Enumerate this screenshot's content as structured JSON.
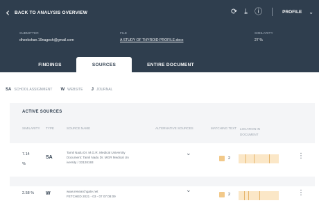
{
  "header": {
    "back_label": "BACK TO ANALYSIS OVERVIEW",
    "profile_label": "PROFILE",
    "icons": [
      "refresh-icon",
      "download-icon",
      "help-icon",
      "chevron-down-icon"
    ]
  },
  "meta": {
    "submitter_label": "SUBMITTER",
    "submitter_value": "dheekshan.19nagesh@gmail.com",
    "file_label": "FILE",
    "file_value": "A STUDY OF THYROID PROFILE.docx",
    "similarity_label": "SIMILARITY",
    "similarity_value": "27 %"
  },
  "tabs": [
    {
      "label": "FINDINGS",
      "active": false
    },
    {
      "label": "SOURCES",
      "active": true
    },
    {
      "label": "ENTIRE DOCUMENT",
      "active": false
    }
  ],
  "filters": [
    {
      "code": "SA",
      "label": "SCHOOL ASSIGNMENT"
    },
    {
      "code": "W",
      "label": "WEBSITE"
    },
    {
      "code": "J",
      "label": "JOURNAL"
    }
  ],
  "sources": {
    "title": "ACTIVE SOURCES",
    "columns": [
      "SIMILARITY",
      "TYPE",
      "SOURCE NAME",
      "ALTERNATIVE SOURCES",
      "MATCHING TEXT",
      "LOCATION IN DOCUMENT"
    ],
    "rows": [
      {
        "similarity_num": "7.14",
        "similarity_unit": "%",
        "type": "SA",
        "source_line1": "Tamil Nadu Dr. M.G.R. Medical University",
        "source_line2": "Document: Tamil Nadu Dr. MGR Medical Un",
        "source_line3": "iversity / 33128193",
        "matching_count": "2"
      },
      {
        "similarity_num": "2.58",
        "similarity_unit": "%",
        "type": "W",
        "source_line1": "www.researchgate.net",
        "source_line2": "FETCHED 2021 - 03 - 07 07:08:09",
        "source_line3": "",
        "matching_count": "2"
      }
    ]
  },
  "colors": {
    "header_bg": "#2f3e4e",
    "panel_bg": "#f4f5f7",
    "match_highlight": "#f2c98a",
    "location_bar": "#fbe7c7"
  }
}
